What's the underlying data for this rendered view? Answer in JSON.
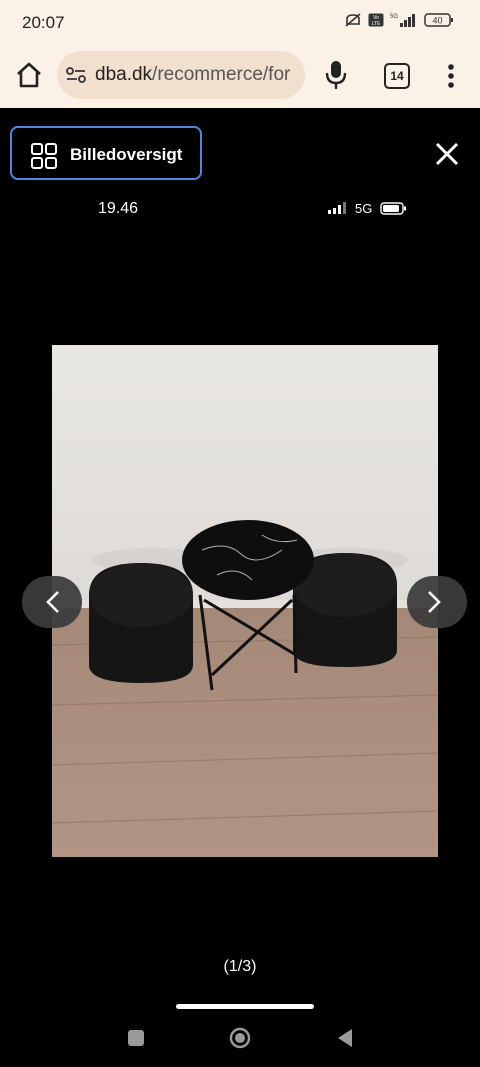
{
  "status_bar": {
    "time": "20:07",
    "battery": "40"
  },
  "browser": {
    "url_domain": "dba.dk",
    "url_path": "/recommerce/for",
    "tab_count": "14"
  },
  "viewer": {
    "overview_label": "Billedoversigt",
    "photo_time": "19.46",
    "photo_network": "5G",
    "counter": "(1/3)"
  },
  "icons": {
    "home": "home-icon",
    "site_settings": "tune-icon",
    "mic": "mic-icon",
    "menu": "more-vert-icon",
    "overview": "grid-icon",
    "close": "close-icon",
    "prev": "chevron-left-icon",
    "next": "chevron-right-icon"
  }
}
